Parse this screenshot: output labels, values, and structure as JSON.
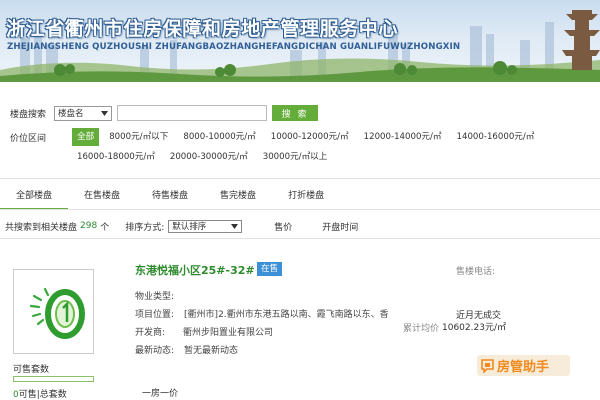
{
  "banner": {
    "title": "浙江省衢州市住房保障和房地产管理服务中心",
    "subtitle": "ZHEJIANGSHENG QUZHOUSHI ZHUFANGBAOZHANGHEFANGDICHAN GUANLIFUWUZHONGXIN"
  },
  "search": {
    "label": "楼盘搜索",
    "select_value": "楼盘名",
    "input_value": "",
    "button": "搜 索"
  },
  "price_filter": {
    "label": "价位区间",
    "items": [
      "全部",
      "8000元/㎡以下",
      "8000-10000元/㎡",
      "10000-12000元/㎡",
      "12000-14000元/㎡",
      "14000-16000元/㎡",
      "16000-18000元/㎡",
      "20000-30000元/㎡",
      "30000元/㎡以上"
    ],
    "active_index": 0
  },
  "tabs": [
    "全部楼盘",
    "在售楼盘",
    "待售楼盘",
    "售完楼盘",
    "打折楼盘"
  ],
  "result_bar": {
    "prefix": "共搜索到相关楼盘",
    "count": "298",
    "suffix": "个",
    "sort_label": "排序方式:",
    "sort_value": "默认排序",
    "sort_price": "售价",
    "sort_open": "开盘时间"
  },
  "listing": {
    "name": "东港悦福小区",
    "name_tail": "25#-32#",
    "status": "在售",
    "property_type_label": "物业类型:",
    "property_type_value": "",
    "location_label": "项目位置:",
    "location_value": "[衢州市]2.衢州市东港五路以南、霞飞南路以东、香",
    "developer_label": "开发商:",
    "developer_value": "衢州步阳置业有限公司",
    "latest_label": "最新动态:",
    "latest_value": "暂无最新动态",
    "single_price": "一房一价",
    "available_label": "可售套数",
    "available_ratio": 0,
    "available_count": "0",
    "total_count_text": "可售|总套数",
    "tel_label": "售楼电话:",
    "recent_deal": "近月无成交",
    "avg_price_label": "累计均价",
    "avg_price_value": "10602.23元/㎡"
  },
  "watermark": {
    "text": "房管助手",
    "accent": "#f08a1d"
  },
  "colors": {
    "accent_green": "#64ad3a",
    "link_green": "#2e8b2e",
    "badge_blue": "#3d8fd6",
    "banner_blue": "#2d5d92"
  },
  "icons": {
    "dropdown": "chevron-down-icon",
    "thumbnail": "project-logo-icon",
    "watermark": "house-chat-icon"
  }
}
